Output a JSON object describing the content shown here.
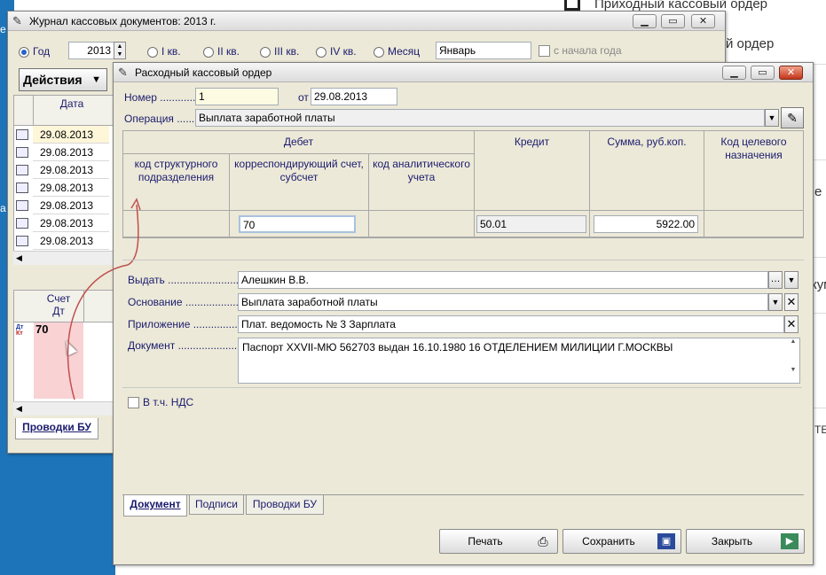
{
  "background": {
    "right_texts": [
      "Приходный кассовый ордер",
      "й ордер",
      "е",
      "кум",
      "ТЕ"
    ],
    "left_texts": [
      "е",
      "а"
    ]
  },
  "journal": {
    "title": "Журнал кассовых документов: 2013 г.",
    "period": {
      "year_label": "Год",
      "year_value": "2013",
      "q1": "I кв.",
      "q2": "II кв.",
      "q3": "III кв.",
      "q4": "IV кв.",
      "month_label": "Месяц",
      "month_value": "Январь",
      "from_start": "с начала года"
    },
    "actions_label": "Действия",
    "date_header": "Дата",
    "dates": [
      "29.08.2013",
      "29.08.2013",
      "29.08.2013",
      "29.08.2013",
      "29.08.2013",
      "29.08.2013",
      "29.08.2013"
    ],
    "account_header_1": "Счет",
    "account_header_2": "Дт",
    "dtkt_top": "Дт",
    "dtkt_bottom": "Кт",
    "account_value": "70",
    "tab_label": "Проводки БУ"
  },
  "order": {
    "title": "Расходный кассовый ордер",
    "number_label": "Номер ............",
    "number_value": "1",
    "from_label": "от",
    "date_value": "29.08.2013",
    "operation_label": "Операция .......",
    "operation_value": "Выплата  заработной платы",
    "table": {
      "debit_header": "Дебет",
      "credit_header": "Кредит",
      "sum_header": "Сумма, руб.коп.",
      "purpose_header_1": "Код целевого",
      "purpose_header_2": "назначения",
      "struct_header_1": "код структурного",
      "struct_header_2": "подразделения",
      "corr_header_1": "корреспондирующий счет,",
      "corr_header_2": "субсчет",
      "analytic_header_1": "код аналитического",
      "analytic_header_2": "учета",
      "corr_value": "70",
      "credit_value": "50.01",
      "sum_value": "5922.00"
    },
    "issue_label": "Выдать ........................",
    "issue_value": "Алешкин В.В.",
    "basis_label": "Основание ....................",
    "basis_value": "Выплата  заработной платы",
    "attachment_label": "Приложение ...................",
    "attachment_value": "Плат. ведомость № 3 Зарплата",
    "document_label": "Документ .....................",
    "document_value": "Паспорт XXVII-МЮ 562703 выдан 16.10.1980 16 ОТДЕЛЕНИЕМ МИЛИЦИИ Г.МОСКВЫ",
    "vat_label": "В т.ч. НДС",
    "tabs": [
      "Документ",
      "Подписи",
      "Проводки БУ"
    ],
    "buttons": {
      "print": "Печать",
      "save": "Сохранить",
      "close": "Закрыть"
    }
  },
  "colors": {
    "desktop_blue": "#1e74b8",
    "window_bg": "#ece9d8",
    "label_text": "#1b1b6e",
    "highlight_pink": "#f9d2d4",
    "arrow_red": "#c0504d"
  }
}
